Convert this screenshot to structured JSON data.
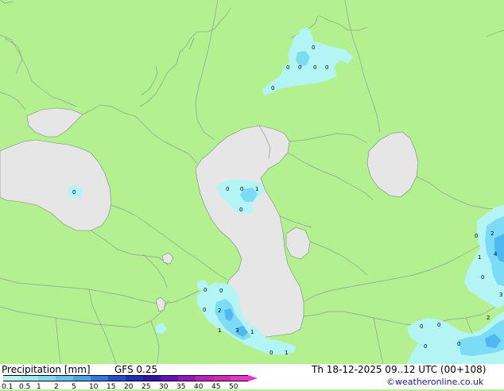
{
  "footer": {
    "title": "Precipitation [mm]",
    "model": "GFS 0.25",
    "valid_time": "Th 18-12-2025 09..12 UTC (00+108)",
    "credit": "©weatheronline.co.uk"
  },
  "colorbar": {
    "tick_labels": [
      "0.1",
      "0.5",
      "1",
      "2",
      "5",
      "10",
      "15",
      "20",
      "25",
      "30",
      "35",
      "40",
      "45",
      "50"
    ],
    "colors": [
      "#b3f5f5",
      "#98ebf5",
      "#7ddcf5",
      "#5ec6f5",
      "#3fa8f0",
      "#2a7ae8",
      "#2050d8",
      "#1a2ec8",
      "#3010b0",
      "#6a0cc0",
      "#9a10c8",
      "#c818c8",
      "#e020b8",
      "#f030d0"
    ]
  },
  "map": {
    "land_color": "#b3f08f",
    "sea_color": "#e6e6e6",
    "precip_light": "#b3f5f5",
    "precip_mid": "#7ddcf5",
    "precip_heavy": "#4fb8f0",
    "values": [
      {
        "name": "value-label-north-1",
        "text": "0"
      },
      {
        "name": "value-label-north-2",
        "text": "0"
      },
      {
        "name": "value-label-north-3",
        "text": "0"
      },
      {
        "name": "value-label-north-4",
        "text": "0"
      },
      {
        "name": "value-label-north-5",
        "text": "0"
      },
      {
        "name": "value-label-north-6",
        "text": "0"
      },
      {
        "name": "value-label-blacksea",
        "text": "0"
      },
      {
        "name": "value-label-caspian-1",
        "text": "0"
      },
      {
        "name": "value-label-caspian-2",
        "text": "0"
      },
      {
        "name": "value-label-caspian-3",
        "text": "1"
      },
      {
        "name": "value-label-caspian-4",
        "text": "0"
      },
      {
        "name": "value-label-south-1",
        "text": "0"
      },
      {
        "name": "value-label-south-2",
        "text": "0"
      },
      {
        "name": "value-label-south-3",
        "text": "0"
      },
      {
        "name": "value-label-south-4",
        "text": "2"
      },
      {
        "name": "value-label-south-5",
        "text": "1"
      },
      {
        "name": "value-label-south-6",
        "text": "3"
      },
      {
        "name": "value-label-south-7",
        "text": "1"
      },
      {
        "name": "value-label-south-8",
        "text": "0"
      },
      {
        "name": "value-label-south-9",
        "text": "1"
      },
      {
        "name": "value-label-east-1",
        "text": "0"
      },
      {
        "name": "value-label-east-2",
        "text": "2"
      },
      {
        "name": "value-label-east-3",
        "text": "1"
      },
      {
        "name": "value-label-east-4",
        "text": "4"
      },
      {
        "name": "value-label-east-5",
        "text": "0"
      },
      {
        "name": "value-label-east-6",
        "text": "3"
      },
      {
        "name": "value-label-east-7",
        "text": "2"
      },
      {
        "name": "value-label-east-8",
        "text": "0"
      },
      {
        "name": "value-label-east-9",
        "text": "0"
      },
      {
        "name": "value-label-east-10",
        "text": "0"
      },
      {
        "name": "value-label-east-11",
        "text": "0"
      }
    ]
  }
}
